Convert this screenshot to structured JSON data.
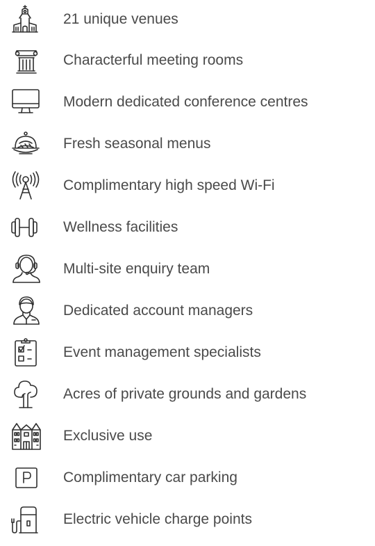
{
  "features": [
    {
      "icon": "venue-building-icon",
      "label": "21 unique venues"
    },
    {
      "icon": "column-pillar-icon",
      "label": "Characterful meeting rooms"
    },
    {
      "icon": "monitor-icon",
      "label": "Modern dedicated conference centres"
    },
    {
      "icon": "food-cloche-icon",
      "label": "Fresh seasonal menus"
    },
    {
      "icon": "wifi-antenna-icon",
      "label": "Complimentary high speed Wi-Fi"
    },
    {
      "icon": "dumbbell-icon",
      "label": "Wellness facilities"
    },
    {
      "icon": "headset-person-icon",
      "label": "Multi-site enquiry team"
    },
    {
      "icon": "account-manager-icon",
      "label": "Dedicated account managers"
    },
    {
      "icon": "clipboard-checklist-icon",
      "label": "Event management specialists"
    },
    {
      "icon": "tree-icon",
      "label": "Acres of private grounds and gardens"
    },
    {
      "icon": "manor-house-icon",
      "label": "Exclusive use"
    },
    {
      "icon": "parking-sign-icon",
      "label": "Complimentary car parking"
    },
    {
      "icon": "ev-charger-icon",
      "label": "Electric vehicle charge points"
    }
  ]
}
